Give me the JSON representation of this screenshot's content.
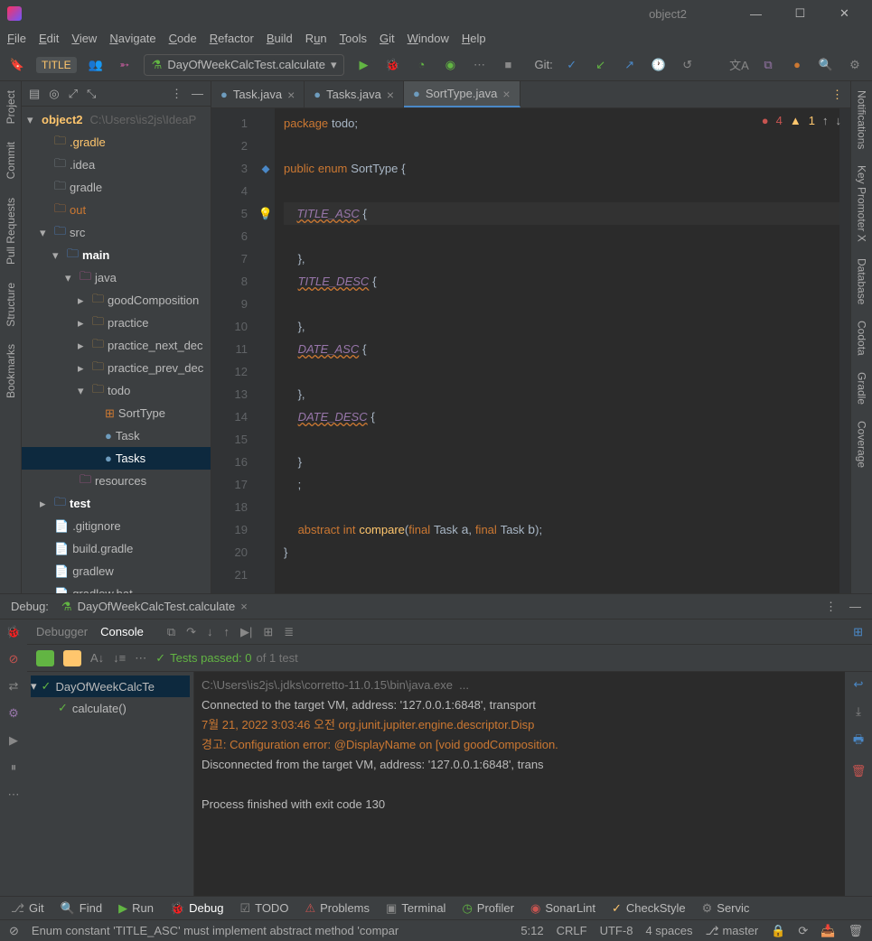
{
  "window": {
    "project": "object2"
  },
  "menu": [
    "File",
    "Edit",
    "View",
    "Navigate",
    "Code",
    "Refactor",
    "Build",
    "Run",
    "Tools",
    "Git",
    "Window",
    "Help"
  ],
  "menu_underline": [
    "F",
    "E",
    "V",
    "N",
    "C",
    "R",
    "B",
    "u",
    "T",
    "G",
    "W",
    "H"
  ],
  "toolbar": {
    "filebadge": "TITLE",
    "runconfig": "DayOfWeekCalcTest.calculate",
    "git_label": "Git:"
  },
  "left_tabs": [
    "Project",
    "Commit",
    "Pull Requests",
    "Structure",
    "Bookmarks"
  ],
  "right_tabs": [
    "Notifications",
    "Key Promoter X",
    "Database",
    "Codota",
    "Gradle",
    "Coverage"
  ],
  "tree": {
    "root_name": "object2",
    "root_path": "C:\\Users\\is2js\\IdeaP",
    "items": [
      {
        "indent": 1,
        "icon": "folder-y",
        "name": ".gradle",
        "hl": true
      },
      {
        "indent": 1,
        "icon": "folder-grey",
        "name": ".idea"
      },
      {
        "indent": 1,
        "icon": "folder-grey",
        "name": "gradle"
      },
      {
        "indent": 1,
        "icon": "folder-or",
        "name": "out",
        "hl": "orange"
      },
      {
        "indent": 1,
        "arrow": "▾",
        "icon": "folder-bl",
        "name": "src"
      },
      {
        "indent": 2,
        "arrow": "▾",
        "icon": "folder-bl",
        "name": "main",
        "bold": true
      },
      {
        "indent": 3,
        "arrow": "▾",
        "icon": "folder-pk",
        "name": "java"
      },
      {
        "indent": 4,
        "arrow": "▸",
        "icon": "folder-y",
        "name": "goodComposition"
      },
      {
        "indent": 4,
        "arrow": "▸",
        "icon": "folder-y",
        "name": "practice"
      },
      {
        "indent": 4,
        "arrow": "▸",
        "icon": "folder-y",
        "name": "practice_next_dec"
      },
      {
        "indent": 4,
        "arrow": "▸",
        "icon": "folder-y",
        "name": "practice_prev_dec"
      },
      {
        "indent": 4,
        "arrow": "▾",
        "icon": "folder-y",
        "name": "todo"
      },
      {
        "indent": 5,
        "icon": "enum",
        "name": "SortType"
      },
      {
        "indent": 5,
        "icon": "class",
        "name": "Task"
      },
      {
        "indent": 5,
        "icon": "class",
        "name": "Tasks",
        "selected": true
      },
      {
        "indent": 3,
        "icon": "folder-pk",
        "name": "resources"
      },
      {
        "indent": 1,
        "arrow": "▸",
        "icon": "folder-bl",
        "name": "test",
        "bold": true
      },
      {
        "indent": 1,
        "icon": "file",
        "name": ".gitignore"
      },
      {
        "indent": 1,
        "icon": "file",
        "name": "build.gradle"
      },
      {
        "indent": 1,
        "icon": "file",
        "name": "gradlew"
      },
      {
        "indent": 1,
        "icon": "file",
        "name": "gradlew.bat"
      }
    ]
  },
  "tabs": [
    {
      "name": "Task.java"
    },
    {
      "name": "Tasks.java"
    },
    {
      "name": "SortType.java",
      "active": true
    }
  ],
  "editor": {
    "warn": {
      "errors": "4",
      "warnings": "1"
    },
    "lines": [
      "1",
      "2",
      "3",
      "4",
      "5",
      "6",
      "7",
      "8",
      "9",
      "10",
      "11",
      "12",
      "13",
      "14",
      "15",
      "16",
      "17",
      "18",
      "19",
      "20",
      "21"
    ]
  },
  "code": {
    "pkg": "package",
    "pkgname": "todo",
    "semi": ";",
    "pub": "public",
    "enum": "enum",
    "cls": "SortType",
    "ob": "{",
    "t1": "TITLE_ASC",
    "t2": "TITLE_DESC",
    "t3": "DATE_ASC",
    "t4": "DATE_DESC",
    "cb_comma": "},",
    "cb": "}",
    "semi2": ";",
    "abs": "abstract",
    "int": "int",
    "cmp": "compare",
    "open": "(",
    "final": "final",
    "task": "Task",
    "a": "a",
    "comma": ",",
    "b": "b",
    "close": ")"
  },
  "debug": {
    "label": "Debug:",
    "tab": "DayOfWeekCalcTest.calculate",
    "sub_tabs": [
      "Debugger",
      "Console"
    ],
    "filter_pass": "Tests passed: 0",
    "filter_total": " of 1 test",
    "test_root": "DayOfWeekCalcTe",
    "test_child": "calculate()",
    "console_lines": [
      {
        "cls": "dim",
        "text": "C:\\Users\\is2js\\.jdks\\corretto-11.0.15\\bin\\java.exe  ..."
      },
      {
        "cls": "",
        "text": "Connected to the target VM, address: '127.0.0.1:6848', transport"
      },
      {
        "cls": "err",
        "text": "7월 21, 2022 3:03:46 오전 org.junit.jupiter.engine.descriptor.Disp"
      },
      {
        "cls": "err",
        "text": "경고: Configuration error: @DisplayName on [void goodComposition."
      },
      {
        "cls": "",
        "text": "Disconnected from the target VM, address: '127.0.0.1:6848', trans"
      },
      {
        "cls": "",
        "text": ""
      },
      {
        "cls": "",
        "text": "Process finished with exit code 130"
      }
    ]
  },
  "bottom": [
    {
      "icon": "⎇",
      "label": "Git"
    },
    {
      "icon": "🔍",
      "label": "Find"
    },
    {
      "icon": "▶",
      "label": "Run",
      "color": "#62b543"
    },
    {
      "icon": "🐞",
      "label": "Debug",
      "active": true,
      "color": "#c75450"
    },
    {
      "icon": "☑",
      "label": "TODO"
    },
    {
      "icon": "⚠",
      "label": "Problems",
      "color": "#c75450"
    },
    {
      "icon": "▣",
      "label": "Terminal"
    },
    {
      "icon": "◷",
      "label": "Profiler",
      "color": "#62b543"
    },
    {
      "icon": "◉",
      "label": "SonarLint",
      "color": "#c75450"
    },
    {
      "icon": "✓",
      "label": "CheckStyle",
      "color": "#ffc66d"
    },
    {
      "icon": "⚙",
      "label": "Servic"
    }
  ],
  "status": {
    "msg": "Enum constant 'TITLE_ASC' must implement abstract method 'compar",
    "pos": "5:12",
    "crlf": "CRLF",
    "enc": "UTF-8",
    "indent": "4 spaces",
    "branch": "master"
  }
}
